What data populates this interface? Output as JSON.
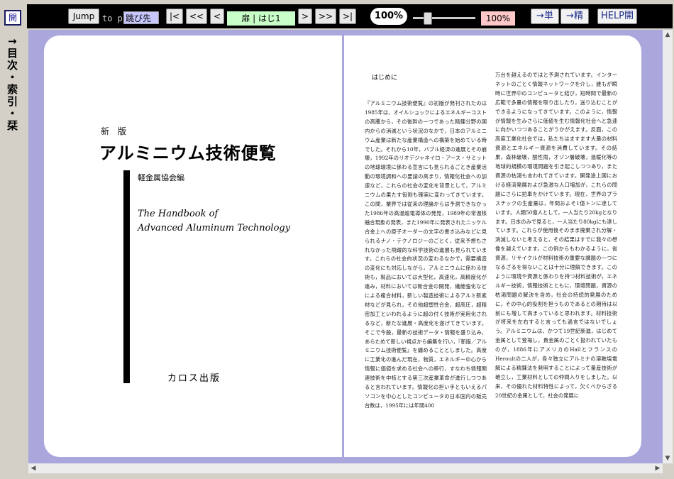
{
  "sidebar": {
    "open_label": "開",
    "toc_label": "↑目次・索引・栞"
  },
  "toolbar": {
    "jump_label": "Jump",
    "to_label": "to p.",
    "page_input_value": "跳び先",
    "first_label": "|<",
    "prev10_label": "<<",
    "prev_label": "<",
    "page_display": "扉 | はじ1",
    "next_label": ">",
    "next10_label": ">>",
    "last_label": ">|",
    "zoom_label": "100%",
    "zoom_level_percent": 100,
    "zoom_display": "100%",
    "single_label": "→単",
    "precise_label": "→精",
    "help_label": "HELP開"
  },
  "book": {
    "left": {
      "edition": "新 版",
      "title": "アルミニウム技術便覧",
      "publisher_assoc": "軽金属協会編",
      "english_title_line1": "The Handbook of",
      "english_title_line2": "Advanced Aluminum Technology",
      "publisher": "カロス出版"
    },
    "right": {
      "section_title": "はじめに",
      "col1": "『アルミニウム技術便覧』の初版が発刊されたのは1985年は，オイルショックによるエネルギーコストの高騰から，その後幹の一つであった精錬分野の国内からの消滅という状況のなかで，日本のアルミニウム産業は新たな産業構造への構築を始めている時でした。それから10年，バブル経済の進展とその崩壊，1992年のリオデジャネイロ・アース・サミットの地球環境に係わる宣言にも見られるごとき産業活動の環境調和への要請の高まり，情報化社会への加速など，これらの社会の変化を背景として，アルミニウムの果たす役割も確実に変わってきています。この間，業界では従来の理論からは予測できなかった1986年の高温超電導体の発見，1989年の常温核融合現象の発表，また1990年に発表されたニッケル合金上への原子オーダーの文字の書き込みなどに見られるナノ・テクノロジーのごとく，従来予想もされなかった飛躍的な科学技術の進展も見られています。これらの社会的状況の変わるなかで，需要構造の変化にも対応しながら，アルミニウムに係わる技術も，製品においては大型化，高速化，高精度化が進み，材料においては新合金の開発，繊維強化などによる複合材料，新しい製造技術によるアルミ新素材などが見られ，その他超塑性合金，超高圧，超精密加工といわれるように超の付く技術が実用化されるなど，新たな進展・高度化を遂げてきています。そこで今般，最新の技術データ・情報を盛り込み，あらためて新しい視点から編集を行い，『新版／アルミニウム技術便覧』を纏めることとしました。高度に工業化の進んだ現在，物質，エネルギー中心から情報に価値を求める社会への移行，すなわち情報関連技術を中核とする第三次産業革命が進行しつつあると言われています。情報化の担い手ともいえるパソコンを中心としたコンピュータの日本国内の販売台数は，1995年には年間400",
      "col2": "万台を越えるのではと予測されています。インターネットのごとく情報ネットワークを介し，誰もが瞬時に世界中のコンピュータと結び，短時間で最新の広範で多量の情報を取り出したり，送り込むことができるようになってきています。このように，情報が情報を生みさらに価値を生む情報化社会へと急速に向かいつつあることがうかがえます。反面，この高度工業化社会では，私たちはますます大量の材料資源とエネルギー資源を消費しています。その結果，森林破壊，酸性雨，オゾン層破壊，温暖化等の地球的規模の環境問題を引き起こしつつあり，また資源の枯渇も言われてきています。開発途上国における経済発展および急激な人口増加が，これらの問題にさらに拍車をかけています。現在，世界のプラスチックの生産量は，年間およそ1億トンに達しています。人類50億人として，一人当たり20kgとなります。日本のみで見ると，一人当たり80kgにも達しています。これらが使用後そのまま廃棄され分解・消滅しないと考えると，その結果はすでに我々の想像を越えています。この例からもわかるように，省資源，リサイクルが材料技術の重要な課題の一つになるざるを得ないことは十分に理解できます。このように環境や資源と係わりを持つ材料技術が，エネルギー技術，情報技術とともに，環境問題，資源の枯渇問題の解決を含め，社会の持続的発展のために，その中心的役割を担うものであるとの期待は以前にも増して高まっていると思われます。材料技術が将来を左右すると言っても過言ではないでしょう。アルミニウムは，かつて19世紀新進，はじめて金属として登場し，貴金属のごとく扱われていたものが，1886年にアメリカのHallとフランスのHeroultの二人が，各々独立にアルミナの溶融塩電解による精錬法を発明することによって量産技術が確立し，工業材料としての仲間入りをしました。以来，その優れた材料特性によって，欠くべからざる20世紀の金属として，社会の発展に"
    }
  }
}
